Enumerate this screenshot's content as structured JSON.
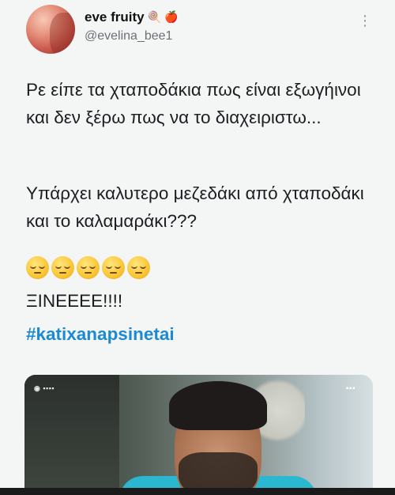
{
  "user": {
    "display_name": "eve fruity",
    "name_emojis": [
      "lollipop-icon",
      "apple-icon"
    ],
    "handle": "@evelina_bee1"
  },
  "menu_icon": "more-options-icon",
  "tweet": {
    "paragraph1": "Ρε είπε τα χταποδάκια πως είναι εξωγήινοι  και δεν ξέρω πως να το διαχειριστω...",
    "paragraph2": "Υπάρχει καλυτερο μεζεδάκι από χταποδάκι και το καλαμαράκι???",
    "emoji_row": [
      "pensive-face-icon",
      "pensive-face-icon",
      "pensive-face-icon",
      "pensive-face-icon",
      "pensive-face-icon"
    ],
    "exclamation": "ΞΙΝΕΕΕΕ!!!!",
    "hashtag": "#katixanapsinetai"
  },
  "colors": {
    "hashtag": "#1b8ad3",
    "handle": "#6b7177",
    "shirt": "#29b8d0"
  }
}
